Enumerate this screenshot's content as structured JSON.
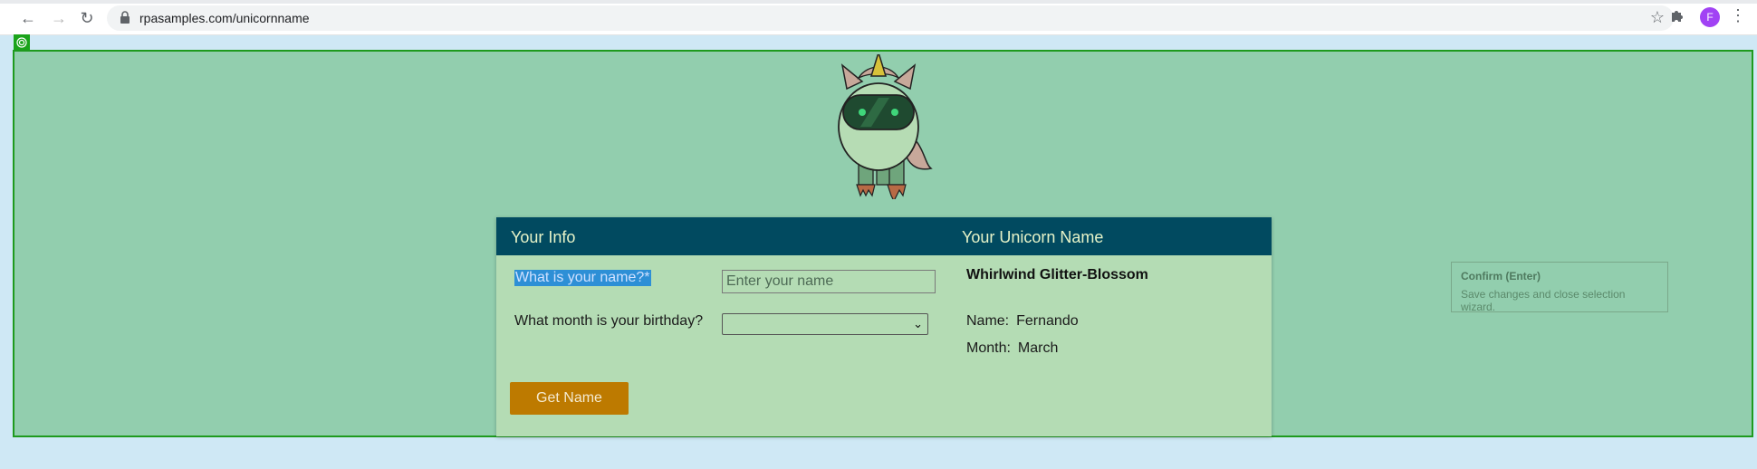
{
  "browser": {
    "url": "rpasamples.com/unicornname",
    "avatar_letter": "F"
  },
  "card": {
    "header_left": "Your Info",
    "header_right": "Your Unicorn Name",
    "name_question": "What is your name?*",
    "name_placeholder": "Enter your name",
    "name_value": "",
    "month_question": "What month is your birthday?",
    "month_selected": "",
    "unicorn_name": "Whirlwind Glitter-Blossom",
    "name_label": "Name:",
    "name_result": "Fernando",
    "month_label": "Month:",
    "month_result": "March",
    "button_label": "Get Name"
  },
  "wizard": {
    "confirm_title": "Confirm (Enter)",
    "confirm_sub": "Save changes and close selection wizard."
  },
  "colors": {
    "page_bg": "#cfe8f5",
    "frame_bg": "#92ceae",
    "frame_border": "#1e9a1e",
    "card_header": "#014a60",
    "card_bg": "#b4dcb4",
    "button_bg": "#bd7a00"
  }
}
